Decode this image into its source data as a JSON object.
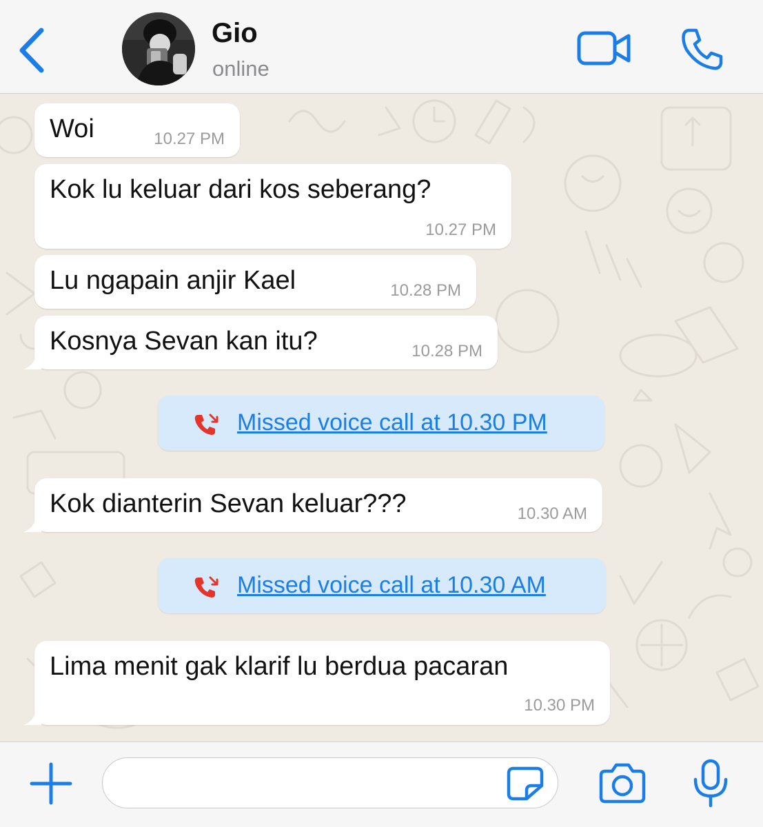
{
  "header": {
    "contact_name": "Gio",
    "status": "online",
    "back_icon": "chevron-left-icon",
    "video_icon": "video-camera-icon",
    "phone_icon": "phone-icon"
  },
  "messages": [
    {
      "type": "text",
      "text": "Woi",
      "time": "10.27 PM"
    },
    {
      "type": "text",
      "text": "Kok lu keluar dari kos seberang?",
      "time": "10.27 PM"
    },
    {
      "type": "text",
      "text": "Lu ngapain anjir Kael",
      "time": "10.28 PM"
    },
    {
      "type": "text",
      "text": "Kosnya Sevan kan itu?",
      "time": "10.28 PM"
    },
    {
      "type": "missed-call",
      "text": "Missed voice call at 10.30 PM"
    },
    {
      "type": "text",
      "text": "Kok dianterin Sevan keluar???",
      "time": "10.30 AM"
    },
    {
      "type": "missed-call",
      "text": "Missed voice call at 10.30 AM"
    },
    {
      "type": "text",
      "text": "Lima menit gak klarif lu berdua pacaran",
      "time": "10.30 PM"
    }
  ],
  "input_bar": {
    "placeholder": "",
    "plus_icon": "plus-icon",
    "sticker_icon": "sticker-icon",
    "camera_icon": "camera-icon",
    "mic_icon": "microphone-icon"
  },
  "colors": {
    "accent": "#1b7ee6",
    "missed_call": "#e5342b",
    "call_bubble": "#d6eafb",
    "chat_background": "#efeae2"
  }
}
